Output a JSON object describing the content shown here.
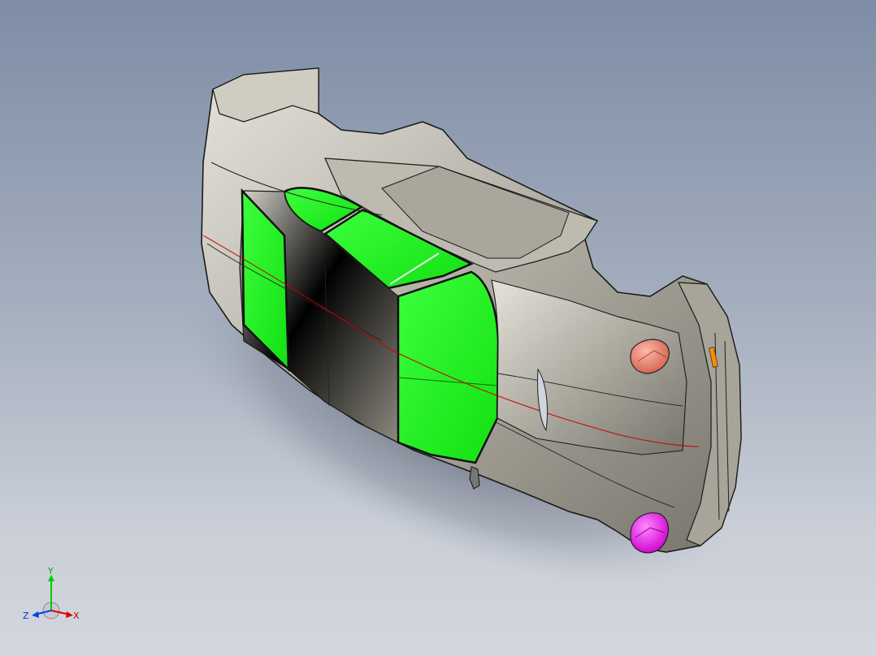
{
  "viewport": {
    "background_top": "#7e8da6",
    "background_bottom": "#d3d7de"
  },
  "model": {
    "body_color": "#b8b4a8",
    "glass_color": "#22ff22",
    "tail_light_color": "#f08a78",
    "fog_light_color": "#ff33ff",
    "reflector_color": "#ff8c00",
    "accent_line_color": "#cc0000"
  },
  "triad": {
    "axis_y": "Y",
    "axis_x": "X",
    "axis_z": "Z",
    "y_color": "#00cc00",
    "x_color": "#dd0000",
    "z_color": "#0044ee"
  }
}
